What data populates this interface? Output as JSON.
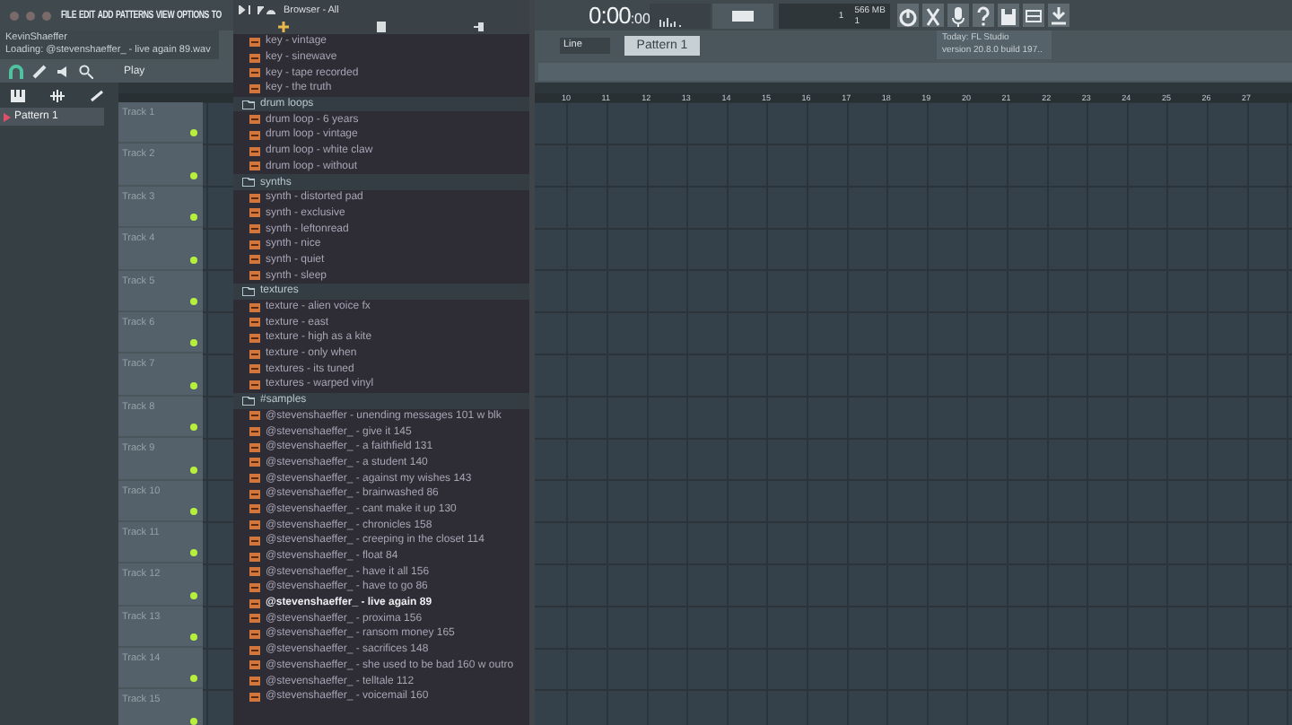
{
  "menu": {
    "items": [
      "FILE",
      "EDIT",
      "ADD",
      "PATTERNS",
      "VIEW",
      "OPTIONS",
      "TO"
    ]
  },
  "hint_panel": {
    "title": "KevinShaeffer",
    "message": "Loading: @stevenshaeffer_ - live again 89.wav"
  },
  "transport": {
    "time": "0:00",
    "time_small": ":00",
    "play_label": "Play"
  },
  "monitor": {
    "memory": "566 MB",
    "cpu": "1",
    "polyphony": "1"
  },
  "toolbar": {
    "snap": "Line",
    "pattern": "Pattern 1",
    "news_title": "Today: FL Studio",
    "news_text": "version 20.8.0 build 197.."
  },
  "browser": {
    "title": "Browser - All",
    "items": [
      {
        "kind": "file",
        "label": "key - vintage",
        "selected": false
      },
      {
        "kind": "file",
        "label": "key - sinewave",
        "selected": false
      },
      {
        "kind": "file",
        "label": "key - tape recorded",
        "selected": false
      },
      {
        "kind": "file",
        "label": "key - the truth",
        "selected": false
      },
      {
        "kind": "folder",
        "label": "drum loops",
        "children": [
          {
            "kind": "file",
            "label": "drum loop - 6 years",
            "selected": false
          },
          {
            "kind": "file",
            "label": "drum loop - vintage",
            "selected": false
          },
          {
            "kind": "file",
            "label": "drum loop - white claw",
            "selected": false
          },
          {
            "kind": "file",
            "label": "drum loop - without",
            "selected": false
          }
        ]
      },
      {
        "kind": "folder",
        "label": "synths",
        "children": [
          {
            "kind": "file",
            "label": "synth - distorted pad",
            "selected": false
          },
          {
            "kind": "file",
            "label": "synth - exclusive",
            "selected": false
          },
          {
            "kind": "file",
            "label": "synth - leftonread",
            "selected": false
          },
          {
            "kind": "file",
            "label": "synth - nice",
            "selected": false
          },
          {
            "kind": "file",
            "label": "synth - quiet",
            "selected": false
          },
          {
            "kind": "file",
            "label": "synth - sleep",
            "selected": false
          }
        ]
      },
      {
        "kind": "folder",
        "label": "textures",
        "children": [
          {
            "kind": "file",
            "label": "texture - alien voice fx",
            "selected": false
          },
          {
            "kind": "file",
            "label": "texture - east",
            "selected": false
          },
          {
            "kind": "file",
            "label": "texture - high as a kite",
            "selected": false
          },
          {
            "kind": "file",
            "label": "texture - only when",
            "selected": false
          },
          {
            "kind": "file",
            "label": "textures - its tuned",
            "selected": false
          },
          {
            "kind": "file",
            "label": "textures - warped vinyl",
            "selected": false
          }
        ]
      },
      {
        "kind": "folder",
        "label": "#samples",
        "children": [
          {
            "kind": "file",
            "label": "@stevenshaeffer - unending messages 101 w blk",
            "selected": false
          },
          {
            "kind": "file",
            "label": "@stevenshaeffer_ - give it 145",
            "selected": false
          },
          {
            "kind": "file",
            "label": "@stevenshaeffer_ - a faithfield 131",
            "selected": false
          },
          {
            "kind": "file",
            "label": "@stevenshaeffer_ - a student 140",
            "selected": false
          },
          {
            "kind": "file",
            "label": "@stevenshaeffer_ - against my wishes 143",
            "selected": false
          },
          {
            "kind": "file",
            "label": "@stevenshaeffer_ - brainwashed 86",
            "selected": false
          },
          {
            "kind": "file",
            "label": "@stevenshaeffer_ - cant make it up 130",
            "selected": false
          },
          {
            "kind": "file",
            "label": "@stevenshaeffer_ - chronicles 158",
            "selected": false
          },
          {
            "kind": "file",
            "label": "@stevenshaeffer_ - creeping in the closet 114",
            "selected": false
          },
          {
            "kind": "file",
            "label": "@stevenshaeffer_ - float 84",
            "selected": false
          },
          {
            "kind": "file",
            "label": "@stevenshaeffer_ - have it all 156",
            "selected": false
          },
          {
            "kind": "file",
            "label": "@stevenshaeffer_ - have to go 86",
            "selected": false
          },
          {
            "kind": "file",
            "label": "@stevenshaeffer_ - live again 89",
            "selected": true
          },
          {
            "kind": "file",
            "label": "@stevenshaeffer_ - proxima 156",
            "selected": false
          },
          {
            "kind": "file",
            "label": "@stevenshaeffer_ - ransom money 165",
            "selected": false
          },
          {
            "kind": "file",
            "label": "@stevenshaeffer_ - sacrifices 148",
            "selected": false
          },
          {
            "kind": "file",
            "label": "@stevenshaeffer_ - she used to be bad 160 w outro",
            "selected": false
          },
          {
            "kind": "file",
            "label": "@stevenshaeffer_ - telltale 112",
            "selected": false
          },
          {
            "kind": "file",
            "label": "@stevenshaeffer_ - voicemail 160",
            "selected": false
          }
        ]
      }
    ]
  },
  "pattern_picker": {
    "items": [
      {
        "label": "Pattern 1",
        "selected": true
      }
    ]
  },
  "playlist": {
    "ruler": [
      "10",
      "11",
      "12",
      "13",
      "14",
      "15",
      "16",
      "17",
      "18",
      "19",
      "20",
      "21",
      "22",
      "23",
      "24",
      "25",
      "26",
      "27"
    ],
    "tracks": [
      {
        "name": "Track 1",
        "on": true
      },
      {
        "name": "Track 2",
        "on": true
      },
      {
        "name": "Track 3",
        "on": true
      },
      {
        "name": "Track 4",
        "on": true
      },
      {
        "name": "Track 5",
        "on": true
      },
      {
        "name": "Track 6",
        "on": true
      },
      {
        "name": "Track 7",
        "on": true
      },
      {
        "name": "Track 8",
        "on": true
      },
      {
        "name": "Track 9",
        "on": true
      },
      {
        "name": "Track 10",
        "on": true
      },
      {
        "name": "Track 11",
        "on": true
      },
      {
        "name": "Track 12",
        "on": true
      },
      {
        "name": "Track 13",
        "on": true
      },
      {
        "name": "Track 14",
        "on": true
      },
      {
        "name": "Track 15",
        "on": true
      }
    ]
  }
}
